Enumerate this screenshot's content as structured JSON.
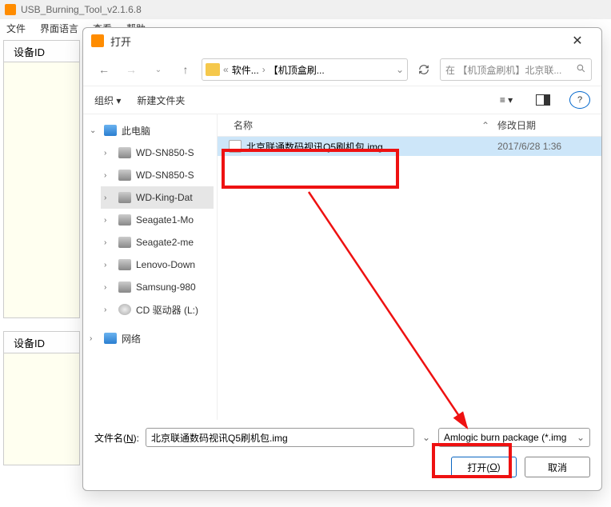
{
  "app": {
    "title": "USB_Burning_Tool_v2.1.6.8",
    "menu": {
      "file": "文件",
      "lang": "界面语言",
      "view": "查看",
      "help": "帮助"
    },
    "pane1_title": "设备ID",
    "pane2_title": "设备ID"
  },
  "dialog": {
    "title": "打开",
    "path": {
      "seg1": "软件...",
      "seg2": "【机顶盒刷..."
    },
    "search_placeholder": "在 【机顶盒刷机】北京联...",
    "toolbar": {
      "organize": "组织",
      "newfolder": "新建文件夹"
    },
    "columns": {
      "name": "名称",
      "date": "修改日期"
    },
    "file": {
      "name": "北京联通数码视讯Q5刷机包.img",
      "date": "2017/6/28 1:36"
    },
    "tree": {
      "root": "此电脑",
      "drives": [
        "WD-SN850-S",
        "WD-SN850-S",
        "WD-King-Dat",
        "Seagate1-Mo",
        "Seagate2-me",
        "Lenovo-Down",
        "Samsung-980",
        "CD 驱动器 (L:)"
      ],
      "network": "网络"
    },
    "footer": {
      "fn_label_pre": "文件名(",
      "fn_label_u": "N",
      "fn_label_post": "):",
      "fn_value": "北京联通数码视讯Q5刷机包.img",
      "filter": "Amlogic burn package (*.img",
      "open_pre": "打开(",
      "open_u": "O",
      "open_post": ")",
      "cancel": "取消"
    }
  }
}
